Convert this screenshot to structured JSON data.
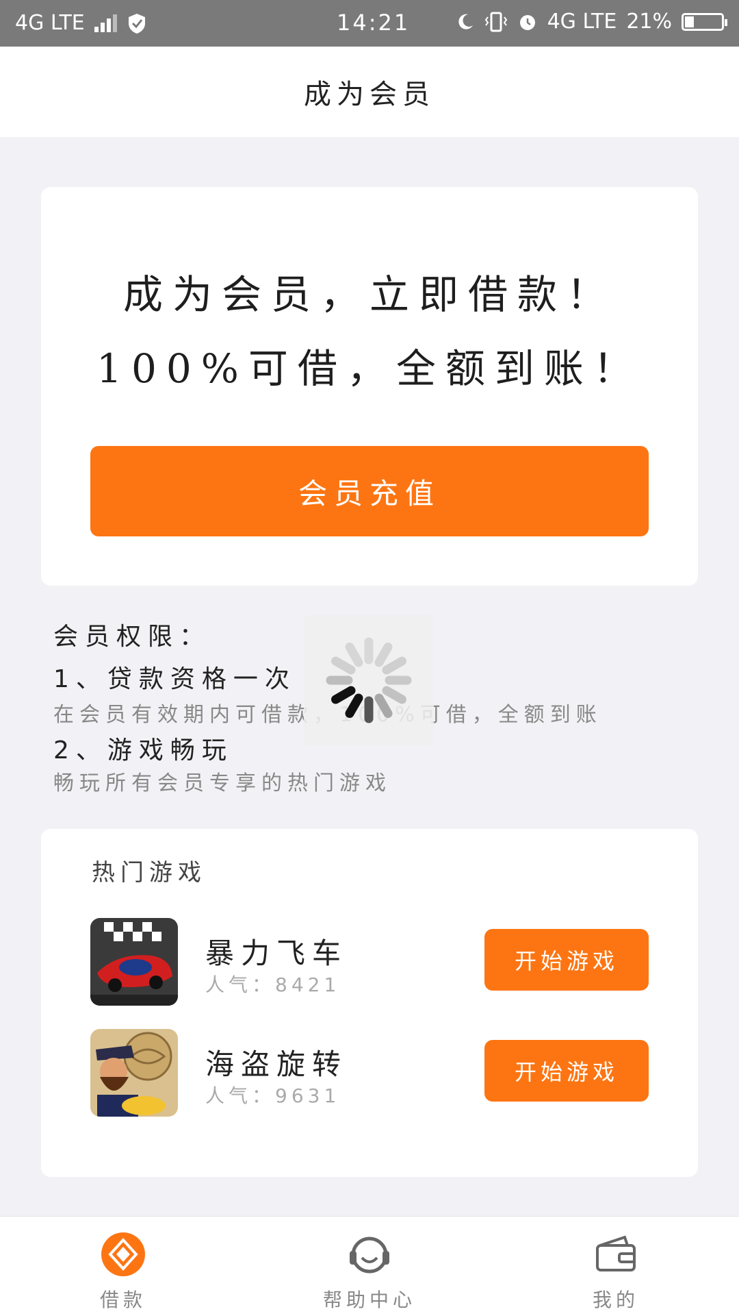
{
  "status_bar": {
    "network_left": "4G LTE",
    "time": "14:21",
    "network_right": "4G LTE",
    "battery": "21%"
  },
  "header": {
    "title": "成为会员"
  },
  "promo": {
    "line1": "成为会员，立即借款！",
    "line2": "100%可借，全额到账！",
    "button_label": "会员充值"
  },
  "privileges": {
    "title": "会员权限：",
    "items": [
      {
        "title": "1、贷款资格一次",
        "desc": "在会员有效期内可借款，100%可借，全额到账"
      },
      {
        "title": "2、游戏畅玩",
        "desc": "畅玩所有会员专享的热门游戏"
      }
    ]
  },
  "games": {
    "title": "热门游戏",
    "list": [
      {
        "name": "暴力飞车",
        "popularity": "人气：8421",
        "button_label": "开始游戏",
        "thumb_icon": "race-car-icon"
      },
      {
        "name": "海盗旋转",
        "popularity": "人气：9631",
        "button_label": "开始游戏",
        "thumb_icon": "pirate-icon"
      }
    ]
  },
  "tabbar": {
    "items": [
      {
        "label": "借款",
        "icon": "loan-icon",
        "active": true
      },
      {
        "label": "帮助中心",
        "icon": "headset-icon",
        "active": false
      },
      {
        "label": "我的",
        "icon": "wallet-icon",
        "active": false
      }
    ]
  },
  "colors": {
    "accent": "#fd7512",
    "background": "#f2f2f6",
    "status_bar": "#7a7a7a"
  }
}
